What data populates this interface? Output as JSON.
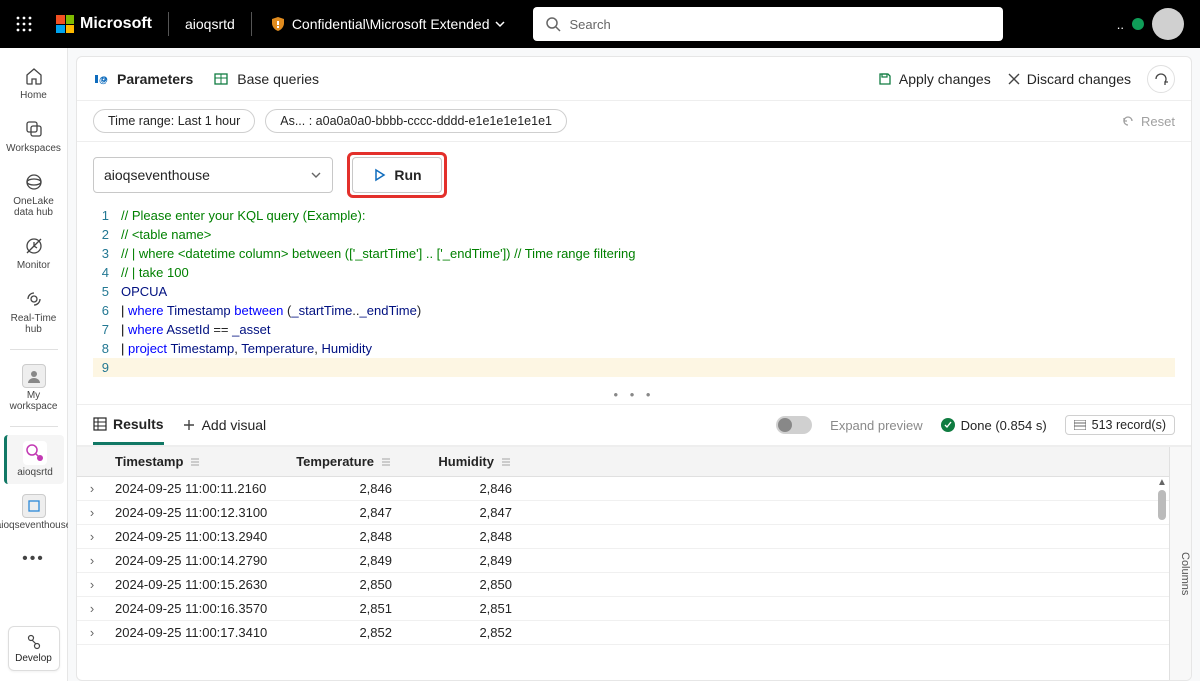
{
  "brand": "Microsoft",
  "workspace_name": "aioqsrtd",
  "sensitivity_label": "Confidential\\Microsoft Extended",
  "search_placeholder": "Search",
  "rail": {
    "home": "Home",
    "workspaces": "Workspaces",
    "onelake": "OneLake data hub",
    "monitor": "Monitor",
    "realtime": "Real-Time hub",
    "myws": "My workspace",
    "pin1": "aioqsrtd",
    "pin2": "aioqseventhouse",
    "develop": "Develop"
  },
  "page": {
    "parameters": "Parameters",
    "base_queries": "Base queries",
    "apply": "Apply changes",
    "discard": "Discard changes",
    "time_range": "Time range: Last 1 hour",
    "asset_chip": "As... : a0a0a0a0-bbbb-cccc-dddd-e1e1e1e1e1e1",
    "reset": "Reset",
    "database": "aioqseventhouse",
    "run": "Run"
  },
  "editor": {
    "lines": [
      "// Please enter your KQL query (Example):",
      "// <table name>",
      "// | where <datetime column> between (['_startTime'] .. ['_endTime']) // Time range filtering",
      "// | take 100",
      "OPCUA",
      "| where Timestamp between (_startTime.._endTime)",
      "| where AssetId == _asset",
      "| project Timestamp, Temperature, Humidity",
      ""
    ]
  },
  "tabs": {
    "results": "Results",
    "add_visual": "Add visual",
    "expand_preview": "Expand preview",
    "done_label": "Done (0.854 s)",
    "records": "513 record(s)",
    "columns_tab": "Columns"
  },
  "grid": {
    "headers": {
      "ts": "Timestamp",
      "temp": "Temperature",
      "hum": "Humidity"
    },
    "rows": [
      {
        "ts": "2024-09-25 11:00:11.2160",
        "temp": "2,846",
        "hum": "2,846"
      },
      {
        "ts": "2024-09-25 11:00:12.3100",
        "temp": "2,847",
        "hum": "2,847"
      },
      {
        "ts": "2024-09-25 11:00:13.2940",
        "temp": "2,848",
        "hum": "2,848"
      },
      {
        "ts": "2024-09-25 11:00:14.2790",
        "temp": "2,849",
        "hum": "2,849"
      },
      {
        "ts": "2024-09-25 11:00:15.2630",
        "temp": "2,850",
        "hum": "2,850"
      },
      {
        "ts": "2024-09-25 11:00:16.3570",
        "temp": "2,851",
        "hum": "2,851"
      },
      {
        "ts": "2024-09-25 11:00:17.3410",
        "temp": "2,852",
        "hum": "2,852"
      }
    ]
  }
}
